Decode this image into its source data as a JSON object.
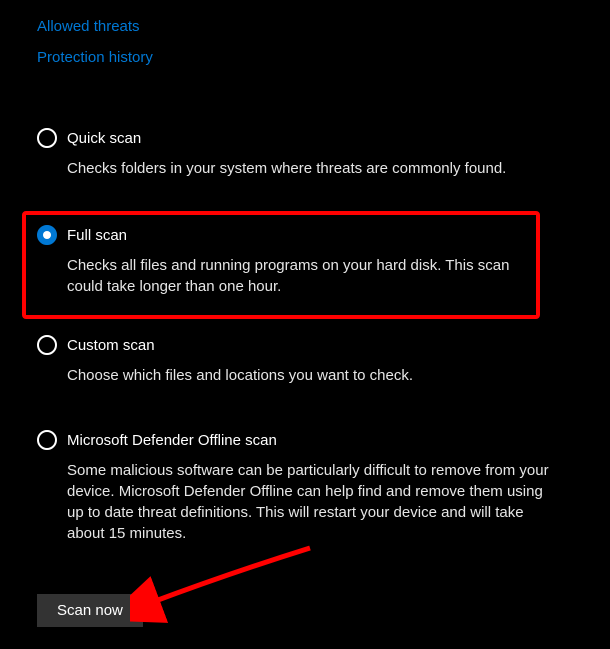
{
  "links": {
    "allowed_threats": "Allowed threats",
    "protection_history": "Protection history"
  },
  "scan_options": {
    "quick": {
      "label": "Quick scan",
      "desc": "Checks folders in your system where threats are commonly found."
    },
    "full": {
      "label": "Full scan",
      "desc": "Checks all files and running programs on your hard disk. This scan could take longer than one hour."
    },
    "custom": {
      "label": "Custom scan",
      "desc": "Choose which files and locations you want to check."
    },
    "offline": {
      "label": "Microsoft Defender Offline scan",
      "desc": "Some malicious software can be particularly difficult to remove from your device. Microsoft Defender Offline can help find and remove them using up to date threat definitions. This will restart your device and will take about 15 minutes."
    }
  },
  "button": {
    "scan_now": "Scan now"
  },
  "selected_option": "full"
}
